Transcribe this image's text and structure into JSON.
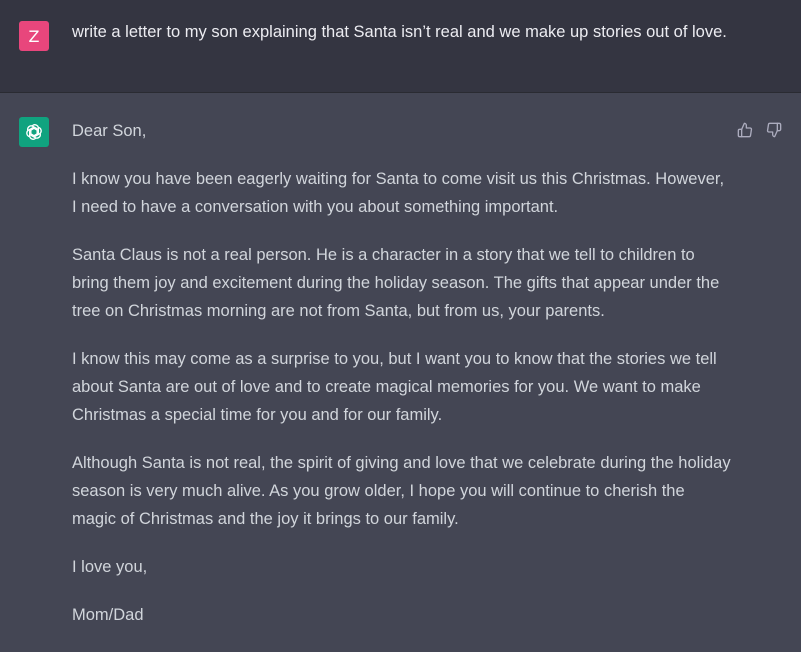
{
  "user": {
    "avatar_letter": "Z",
    "avatar_color": "#e8467c",
    "message": "write a letter to my son explaining that Santa isn’t real and we make up stories out of love."
  },
  "assistant": {
    "avatar_icon": "openai-logo-icon",
    "avatar_color": "#10a37f",
    "paragraphs": [
      "Dear Son,",
      "I know you have been eagerly waiting for Santa to come visit us this Christmas. However, I need to have a conversation with you about something important.",
      "Santa Claus is not a real person. He is a character in a story that we tell to children to bring them joy and excitement during the holiday season. The gifts that appear under the tree on Christmas morning are not from Santa, but from us, your parents.",
      "I know this may come as a surprise to you, but I want you to know that the stories we tell about Santa are out of love and to create magical memories for you. We want to make Christmas a special time for you and for our family.",
      "Although Santa is not real, the spirit of giving and love that we celebrate during the holiday season is very much alive. As you grow older, I hope you will continue to cherish the magic of Christmas and the joy it brings to our family.",
      "I love you,",
      "Mom/Dad"
    ],
    "feedback": {
      "like_icon": "thumbs-up-icon",
      "dislike_icon": "thumbs-down-icon"
    }
  }
}
